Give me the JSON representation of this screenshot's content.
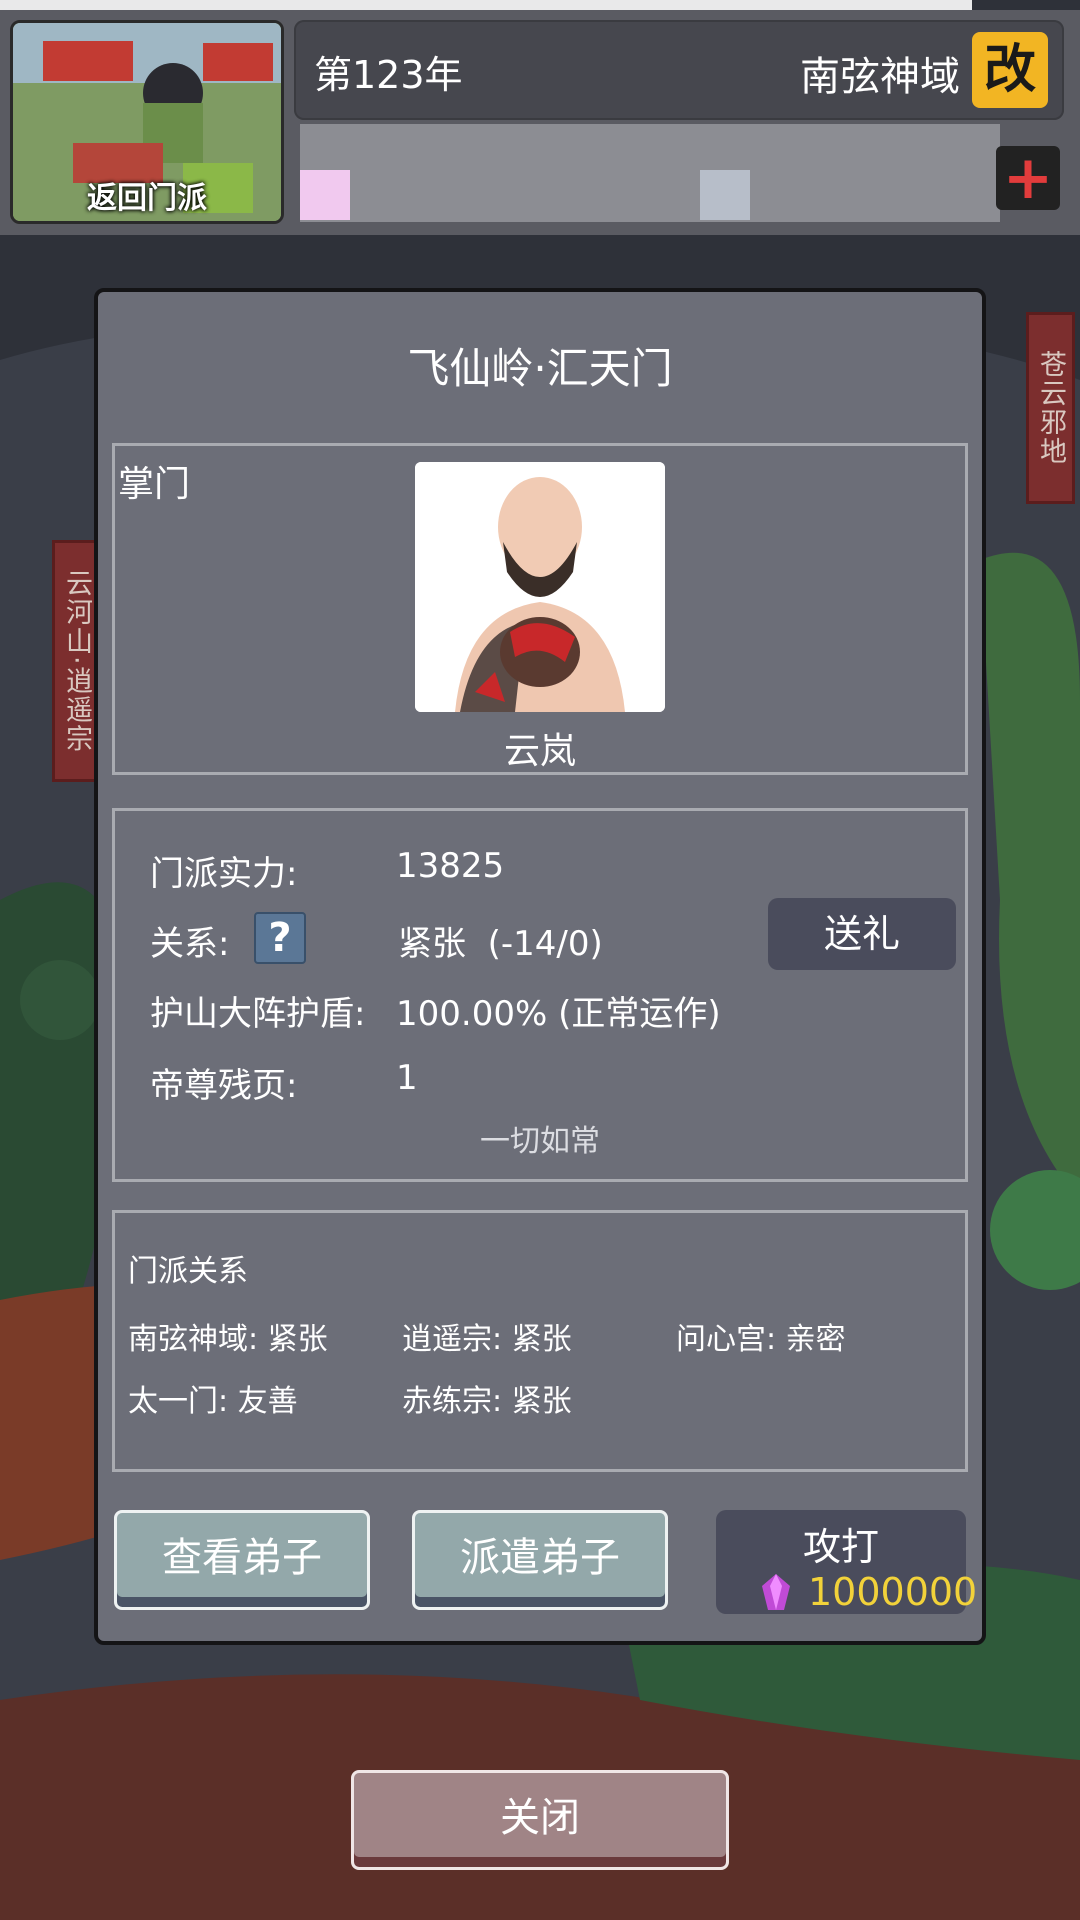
{
  "header": {
    "return_label": "返回门派",
    "year": "第123年",
    "region": "南弦神域",
    "change_label": "改",
    "add_label": "+"
  },
  "side_banners": {
    "left": "云河山·逍遥宗",
    "right": "苍云邪地"
  },
  "dialog": {
    "title": "飞仙岭·汇天门",
    "leader_label": "掌门",
    "leader_name": "云岚",
    "stats": {
      "power_label": "门派实力:",
      "power_value": "13825",
      "relation_label": "关系:",
      "relation_value": "紧张  (-14/0)",
      "shield_label": "护山大阵护盾:",
      "shield_value": "100.00% (正常运作)",
      "pages_label": "帝尊残页:",
      "pages_value": "1",
      "status_note": "一切如常",
      "gift_label": "送礼"
    },
    "relations": {
      "title": "门派关系",
      "items": [
        "南弦神域: 紧张",
        "逍遥宗: 紧张",
        "问心宫: 亲密",
        "太一门: 友善",
        "赤练宗: 紧张"
      ]
    },
    "buttons": {
      "view_disciples": "查看弟子",
      "send_disciples": "派遣弟子",
      "attack": "攻打",
      "attack_cost": "1000000"
    }
  },
  "close_label": "关闭",
  "colors": {
    "dialog_bg": "#6c6e78",
    "gold": "#f2b523",
    "cost_text": "#f2d23a",
    "banner_red": "#7c2e2e"
  }
}
